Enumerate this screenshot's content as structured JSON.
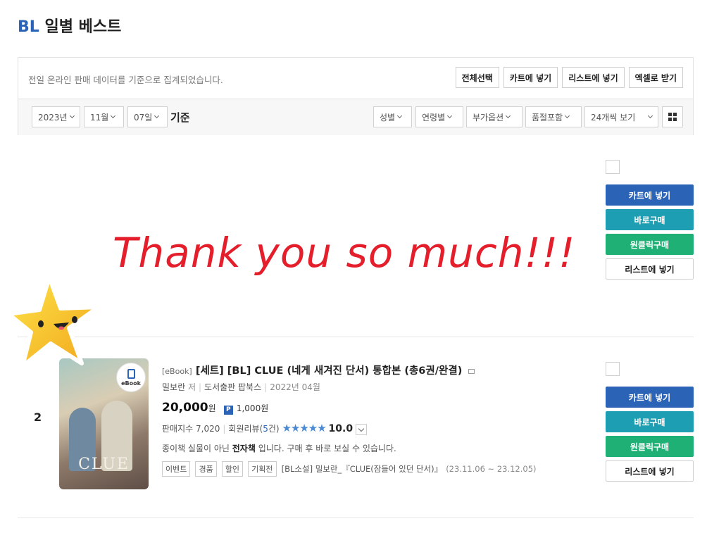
{
  "header": {
    "prefix": "BL",
    "title": "일별 베스트"
  },
  "panel": {
    "note": "전일 온라인 판매 데이터를 기준으로 집계되었습니다.",
    "buttons": [
      "전체선택",
      "카트에 넣기",
      "리스트에 넣기",
      "엑셀로 받기"
    ],
    "date": {
      "year": "2023년",
      "month": "11월",
      "day": "07일",
      "suffix": "기준"
    },
    "filters": [
      "성별",
      "연령별",
      "부가옵션",
      "품절포함",
      "24개씩 보기"
    ]
  },
  "overlay": {
    "thanks_text": "Thank you so much!!!"
  },
  "item1": {
    "actions": [
      "카트에 넣기",
      "바로구매",
      "원클릭구매",
      "리스트에 넣기"
    ]
  },
  "item2": {
    "rank": "2",
    "cover_badge": "eBook",
    "cover_title": "CLUE",
    "format_tag": "[eBook]",
    "title": "[세트] [BL] CLUE (네게 새겨진 단서) 통합본 (총6권/완결)",
    "author": "밀보란",
    "author_role": "저",
    "publisher": "도서출판 팝북스",
    "date": "2022년 04월",
    "price": "20,000",
    "price_unit": "원",
    "point_badge": "P",
    "points": "1,000원",
    "sales_label": "판매지수",
    "sales_value": "7,020",
    "review_label": "회원리뷰(",
    "review_count": "5",
    "review_suffix": "건)",
    "rating_stars": "★★★★★",
    "rating": "10.0",
    "desc_before": "종이책 실물이 아닌 ",
    "desc_bold": "전자책",
    "desc_after": " 입니다. 구매 후 바로 보실 수 있습니다.",
    "chips": [
      "이벤트",
      "경품",
      "할인",
      "기획전"
    ],
    "promo": "[BL소설] 밀보란_『CLUE(잠들어 있던 단서)』",
    "promo_dates": "(23.11.06 ~ 23.12.05)",
    "actions": [
      "카트에 넣기",
      "바로구매",
      "원클릭구매",
      "리스트에 넣기"
    ]
  },
  "colors": {
    "accent_blue": "#2b63b6",
    "teal": "#1e9eb3",
    "green": "#1fb076",
    "thanks_red": "#e41e2a",
    "star_yellow": "#f7c21a"
  }
}
